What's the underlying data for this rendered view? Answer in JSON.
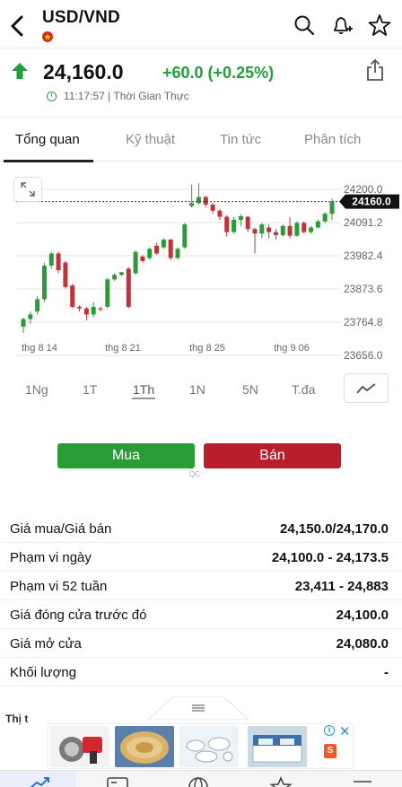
{
  "header": {
    "symbol": "USD/VND",
    "flag_icon": "vietnam-flag-icon",
    "icons": [
      "search-icon",
      "bell-plus-icon",
      "star-icon"
    ]
  },
  "quote": {
    "price": "24,160.0",
    "change": "+60.0 (+0.25%)",
    "time": "11:17:57 | Thời Gian Thực",
    "direction": "up",
    "up_color": "#1f9e3a"
  },
  "tabs": [
    {
      "label": "Tổng quan",
      "active": true
    },
    {
      "label": "Kỹ thuật",
      "active": false
    },
    {
      "label": "Tin tức",
      "active": false
    },
    {
      "label": "Phân tích",
      "active": false
    }
  ],
  "chart": {
    "y_ticks": [
      "24200.0",
      "24091.2",
      "23982.4",
      "23873.6",
      "23764.8",
      "23656.0"
    ],
    "x_ticks": [
      "thg 8 14",
      "thg 8 21",
      "thg 8 25",
      "thg 9 06"
    ],
    "current_label": "24160.0"
  },
  "chart_data": {
    "type": "candlestick",
    "ylim": [
      23656.0,
      24200.0
    ],
    "up_color": "#2a9c36",
    "down_color": "#c0333a",
    "candles": [
      {
        "o": 23750,
        "h": 23780,
        "l": 23730,
        "c": 23775
      },
      {
        "o": 23775,
        "h": 23800,
        "l": 23760,
        "c": 23790
      },
      {
        "o": 23800,
        "h": 23850,
        "l": 23790,
        "c": 23840
      },
      {
        "o": 23840,
        "h": 23960,
        "l": 23830,
        "c": 23950
      },
      {
        "o": 23950,
        "h": 23995,
        "l": 23940,
        "c": 23990
      },
      {
        "o": 23990,
        "h": 23995,
        "l": 23925,
        "c": 23935
      },
      {
        "o": 23960,
        "h": 23965,
        "l": 23875,
        "c": 23880
      },
      {
        "o": 23885,
        "h": 23890,
        "l": 23810,
        "c": 23815
      },
      {
        "o": 23815,
        "h": 23820,
        "l": 23800,
        "c": 23810
      },
      {
        "o": 23810,
        "h": 23815,
        "l": 23770,
        "c": 23790
      },
      {
        "o": 23790,
        "h": 23830,
        "l": 23780,
        "c": 23815
      },
      {
        "o": 23810,
        "h": 23815,
        "l": 23800,
        "c": 23808
      },
      {
        "o": 23815,
        "h": 23910,
        "l": 23810,
        "c": 23905
      },
      {
        "o": 23905,
        "h": 23925,
        "l": 23900,
        "c": 23920
      },
      {
        "o": 23920,
        "h": 23930,
        "l": 23915,
        "c": 23928
      },
      {
        "o": 23940,
        "h": 23945,
        "l": 23810,
        "c": 23815
      },
      {
        "o": 23925,
        "h": 24000,
        "l": 23920,
        "c": 23995
      },
      {
        "o": 23980,
        "h": 23985,
        "l": 23960,
        "c": 23965
      },
      {
        "o": 23975,
        "h": 24010,
        "l": 23970,
        "c": 24005
      },
      {
        "o": 24015,
        "h": 24025,
        "l": 23985,
        "c": 23990
      },
      {
        "o": 24010,
        "h": 24040,
        "l": 24005,
        "c": 24035
      },
      {
        "o": 24035,
        "h": 24038,
        "l": 23968,
        "c": 23975
      },
      {
        "o": 23975,
        "h": 24010,
        "l": 23970,
        "c": 24005
      },
      {
        "o": 24010,
        "h": 24090,
        "l": 24005,
        "c": 24085
      },
      {
        "o": 24145,
        "h": 24215,
        "l": 24140,
        "c": 24155
      },
      {
        "o": 24155,
        "h": 24220,
        "l": 24150,
        "c": 24175
      },
      {
        "o": 24175,
        "h": 24178,
        "l": 24140,
        "c": 24150
      },
      {
        "o": 24150,
        "h": 24155,
        "l": 24120,
        "c": 24130
      },
      {
        "o": 24130,
        "h": 24135,
        "l": 24100,
        "c": 24110
      },
      {
        "o": 24110,
        "h": 24115,
        "l": 24045,
        "c": 24060
      },
      {
        "o": 24060,
        "h": 24110,
        "l": 24055,
        "c": 24100
      },
      {
        "o": 24100,
        "h": 24118,
        "l": 24080,
        "c": 24112
      },
      {
        "o": 24110,
        "h": 24112,
        "l": 24060,
        "c": 24070
      },
      {
        "o": 24070,
        "h": 24075,
        "l": 23990,
        "c": 24055
      },
      {
        "o": 24055,
        "h": 24090,
        "l": 24040,
        "c": 24085
      },
      {
        "o": 24075,
        "h": 24085,
        "l": 24040,
        "c": 24060
      },
      {
        "o": 24060,
        "h": 24070,
        "l": 24035,
        "c": 24050
      },
      {
        "o": 24050,
        "h": 24085,
        "l": 24045,
        "c": 24080
      },
      {
        "o": 24080,
        "h": 24110,
        "l": 24040,
        "c": 24048
      },
      {
        "o": 24048,
        "h": 24095,
        "l": 24045,
        "c": 24090
      },
      {
        "o": 24090,
        "h": 24095,
        "l": 24055,
        "c": 24060
      },
      {
        "o": 24060,
        "h": 24080,
        "l": 24055,
        "c": 24075
      },
      {
        "o": 24075,
        "h": 24100,
        "l": 24072,
        "c": 24095
      },
      {
        "o": 24095,
        "h": 24125,
        "l": 24090,
        "c": 24120
      },
      {
        "o": 24120,
        "h": 24170,
        "l": 24100,
        "c": 24160
      }
    ]
  },
  "ranges": [
    {
      "label": "1Ng",
      "active": false
    },
    {
      "label": "1T",
      "active": false
    },
    {
      "label": "1Th",
      "active": true
    },
    {
      "label": "1N",
      "active": false
    },
    {
      "label": "5N",
      "active": false
    },
    {
      "label": "T.đa",
      "active": false
    }
  ],
  "actions": {
    "buy_label": "Mua",
    "sell_label": "Bán",
    "ad_tag": "QC",
    "buy_color": "#2a9c36",
    "sell_color": "#b91f2b"
  },
  "stats": [
    {
      "label": "Giá mua/Giá bán",
      "value": "24,150.0/24,170.0"
    },
    {
      "label": "Phạm vi ngày",
      "value": "24,100.0 - 24,173.5"
    },
    {
      "label": "Phạm vi 52 tuần",
      "value": "23,411 - 24,883"
    },
    {
      "label": "Giá đóng cửa trước đó",
      "value": "24,100.0"
    },
    {
      "label": "Giá mở cửa",
      "value": "24,080.0"
    },
    {
      "label": "Khối lượng",
      "value": "-"
    }
  ],
  "bottom": {
    "peek_text": "Thị t",
    "nav_icons": [
      "markets-icon",
      "news-icon",
      "globe-icon",
      "watchlist-star-icon",
      "menu-icon"
    ]
  }
}
